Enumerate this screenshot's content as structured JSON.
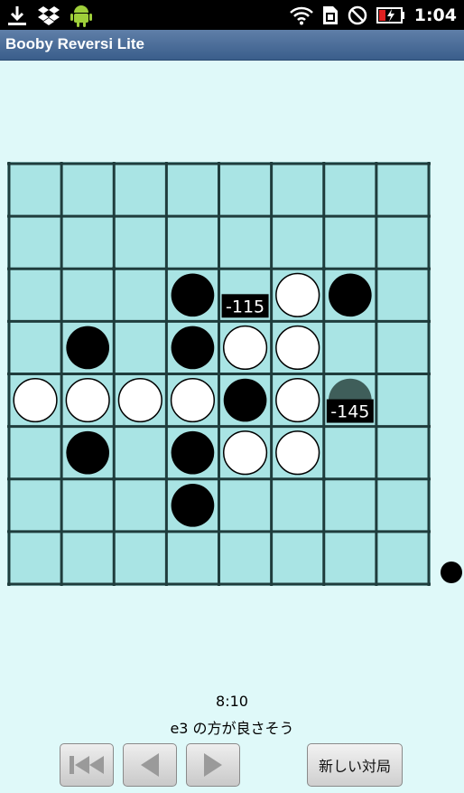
{
  "status_bar": {
    "time": "1:04",
    "left_icons": [
      "download-icon",
      "dropbox-icon",
      "android-icon"
    ],
    "right_icons": [
      "wifi-icon",
      "sim-icon",
      "no-disturb-icon",
      "battery-charging-icon"
    ]
  },
  "app": {
    "title": "Booby Reversi Lite"
  },
  "colors": {
    "background": "#dff9f9",
    "board": "#a9e4e4",
    "grid": "#1f3c3c",
    "title_bar": "#4a6d99",
    "black": "#000000",
    "white": "#ffffff",
    "ghost": "#3f5e5a"
  },
  "board": {
    "size": 8,
    "cells": [
      [
        "",
        "",
        "",
        "",
        "",
        "",
        "",
        ""
      ],
      [
        "",
        "",
        "",
        "",
        "",
        "",
        "",
        ""
      ],
      [
        "",
        "",
        "",
        "B",
        "",
        "W",
        "B",
        ""
      ],
      [
        "",
        "B",
        "",
        "B",
        "W",
        "W",
        "",
        ""
      ],
      [
        "W",
        "W",
        "W",
        "W",
        "B",
        "W",
        "",
        ""
      ],
      [
        "",
        "B",
        "",
        "B",
        "W",
        "W",
        "",
        ""
      ],
      [
        "",
        "",
        "",
        "B",
        "",
        "",
        "",
        ""
      ],
      [
        "",
        "",
        "",
        "",
        "",
        "",
        "",
        ""
      ]
    ],
    "evaluations": [
      {
        "row": 2,
        "col": 4,
        "label": "-115"
      },
      {
        "row": 4,
        "col": 6,
        "label": "-145"
      }
    ],
    "ghost_piece": {
      "row": 4,
      "col": 6
    }
  },
  "side_indicator": "black",
  "footer": {
    "score": "8:10",
    "hint": "e3 の方が良さそう",
    "new_game_label": "新しい対局"
  }
}
